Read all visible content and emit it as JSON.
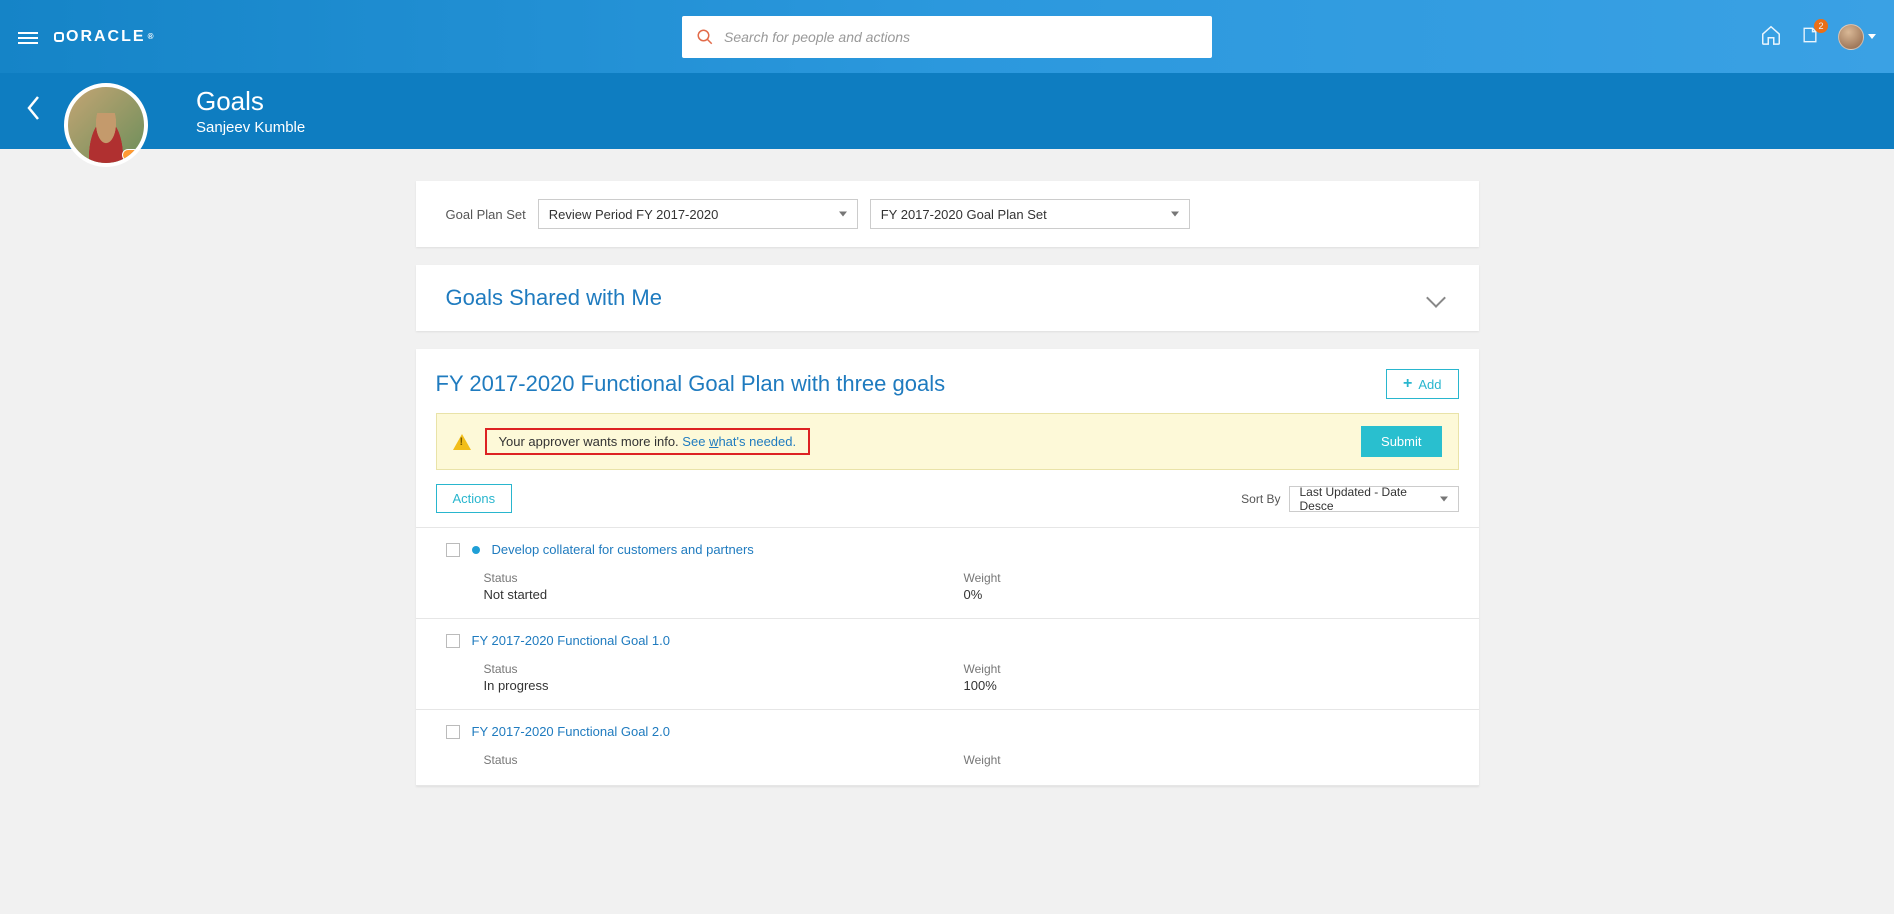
{
  "header": {
    "brand": "ORACLE",
    "search_placeholder": "Search for people and actions",
    "notif_count": "2"
  },
  "page": {
    "title": "Goals",
    "user": "Sanjeev Kumble"
  },
  "filters": {
    "label": "Goal Plan Set",
    "review_period": "Review Period FY 2017-2020",
    "plan_set": "FY 2017-2020 Goal Plan Set"
  },
  "shared": {
    "title": "Goals Shared with Me"
  },
  "plan": {
    "title": "FY 2017-2020 Functional Goal Plan with three goals",
    "add_label": "Add",
    "alert_text": "Your approver wants more info.",
    "alert_link": "See what's needed.",
    "submit_label": "Submit",
    "actions_label": "Actions",
    "sortby_label": "Sort By",
    "sortby_value": "Last Updated - Date Desce"
  },
  "column_labels": {
    "status": "Status",
    "weight": "Weight"
  },
  "goals": [
    {
      "name": "Develop collateral for customers and partners",
      "has_dot": true,
      "status": "Not started",
      "weight": "0%"
    },
    {
      "name": "FY 2017-2020 Functional Goal 1.0",
      "has_dot": false,
      "status": "In progress",
      "weight": "100%"
    },
    {
      "name": "FY 2017-2020 Functional Goal 2.0",
      "has_dot": false,
      "status": "",
      "weight": ""
    }
  ]
}
